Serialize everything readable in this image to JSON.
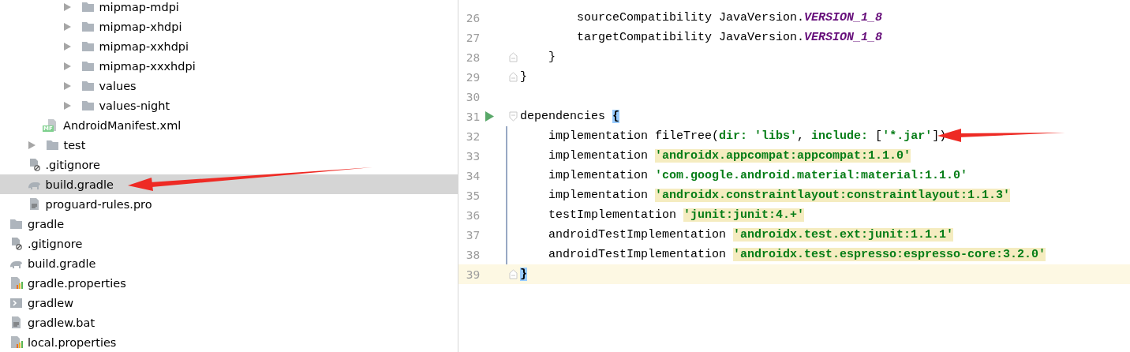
{
  "project_tree": {
    "items": [
      {
        "children": [
          {
            "children": [
              {
                "children": [
                  {
                    "label": "mipmap-mdpi",
                    "kind": "folder",
                    "expandable": true,
                    "selected": false
                  },
                  {
                    "label": "mipmap-xhdpi",
                    "kind": "folder",
                    "expandable": true,
                    "selected": false
                  },
                  {
                    "label": "mipmap-xxhdpi",
                    "kind": "folder",
                    "expandable": true,
                    "selected": false
                  },
                  {
                    "label": "mipmap-xxxhdpi",
                    "kind": "folder",
                    "expandable": true,
                    "selected": false
                  },
                  {
                    "label": "values",
                    "kind": "folder",
                    "expandable": true,
                    "selected": false
                  },
                  {
                    "label": "values-night",
                    "kind": "folder",
                    "expandable": true,
                    "selected": false
                  }
                ]
              },
              {
                "label": "AndroidManifest.xml",
                "kind": "manifest",
                "badge": "MF",
                "expandable": false,
                "selected": false
              }
            ]
          },
          {
            "label": "test",
            "kind": "folder",
            "expandable": true,
            "selected": false
          },
          {
            "label": ".gitignore",
            "kind": "ignore",
            "expandable": false,
            "selected": false
          },
          {
            "label": "build.gradle",
            "kind": "gradle",
            "expandable": false,
            "selected": true
          },
          {
            "label": "proguard-rules.pro",
            "kind": "text",
            "expandable": false,
            "selected": false
          }
        ]
      },
      {
        "label": "gradle",
        "kind": "folder",
        "expandable": false,
        "selected": false
      },
      {
        "label": ".gitignore",
        "kind": "ignore",
        "expandable": false,
        "selected": false
      },
      {
        "label": "build.gradle",
        "kind": "gradle",
        "expandable": false,
        "selected": false
      },
      {
        "label": "gradle.properties",
        "kind": "properties",
        "expandable": false,
        "selected": false
      },
      {
        "label": "gradlew",
        "kind": "shell",
        "expandable": false,
        "selected": false
      },
      {
        "label": "gradlew.bat",
        "kind": "text",
        "expandable": false,
        "selected": false
      },
      {
        "label": "local.properties",
        "kind": "properties",
        "expandable": false,
        "selected": false
      }
    ]
  },
  "editor": {
    "lines": [
      {
        "number": "26",
        "fold_start": false,
        "fold_end": false,
        "run": false,
        "current": false,
        "changed": false,
        "tokens": [
          {
            "kind": "plain",
            "text": "        sourceCompatibility JavaVersion."
          },
          {
            "kind": "constant",
            "text": "VERSION_1_8"
          }
        ]
      },
      {
        "number": "27",
        "fold_start": false,
        "fold_end": false,
        "run": false,
        "current": false,
        "changed": false,
        "tokens": [
          {
            "kind": "plain",
            "text": "        targetCompatibility JavaVersion."
          },
          {
            "kind": "constant",
            "text": "VERSION_1_8"
          }
        ]
      },
      {
        "number": "28",
        "fold_start": false,
        "fold_end": true,
        "run": false,
        "current": false,
        "changed": false,
        "tokens": [
          {
            "kind": "plain",
            "text": "    }"
          }
        ]
      },
      {
        "number": "29",
        "fold_start": false,
        "fold_end": true,
        "run": false,
        "current": false,
        "changed": false,
        "tokens": [
          {
            "kind": "plain",
            "text": "}"
          }
        ]
      },
      {
        "number": "30",
        "fold_start": false,
        "fold_end": false,
        "run": false,
        "current": false,
        "changed": false
      },
      {
        "number": "31",
        "fold_start": true,
        "fold_end": false,
        "run": true,
        "current": false,
        "changed": false,
        "tokens": [
          {
            "kind": "plain",
            "text": "dependencies "
          },
          {
            "kind": "brace",
            "matched": true,
            "text": "{"
          }
        ]
      },
      {
        "number": "32",
        "fold_start": false,
        "fold_end": false,
        "run": false,
        "current": false,
        "changed": true,
        "tokens": [
          {
            "kind": "plain",
            "text": "    implementation fileTree("
          },
          {
            "kind": "named",
            "text": "dir: "
          },
          {
            "kind": "string",
            "highlighted": false,
            "text": "'libs'"
          },
          {
            "kind": "plain",
            "text": ", "
          },
          {
            "kind": "named",
            "text": "include: "
          },
          {
            "kind": "plain",
            "text": "["
          },
          {
            "kind": "string",
            "highlighted": false,
            "text": "'*.jar'"
          },
          {
            "kind": "plain",
            "text": "])"
          }
        ]
      },
      {
        "number": "33",
        "fold_start": false,
        "fold_end": false,
        "run": false,
        "current": false,
        "changed": true,
        "tokens": [
          {
            "kind": "plain",
            "text": "    implementation "
          },
          {
            "kind": "string",
            "highlighted": true,
            "text": "'androidx.appcompat:appcompat:1.1.0'"
          }
        ]
      },
      {
        "number": "34",
        "fold_start": false,
        "fold_end": false,
        "run": false,
        "current": false,
        "changed": true,
        "tokens": [
          {
            "kind": "plain",
            "text": "    implementation "
          },
          {
            "kind": "string",
            "highlighted": false,
            "text": "'com.google.android.material:material:1.1.0'"
          }
        ]
      },
      {
        "number": "35",
        "fold_start": false,
        "fold_end": false,
        "run": false,
        "current": false,
        "changed": true,
        "tokens": [
          {
            "kind": "plain",
            "text": "    implementation "
          },
          {
            "kind": "string",
            "highlighted": true,
            "text": "'androidx.constraintlayout:constraintlayout:1.1.3'"
          }
        ]
      },
      {
        "number": "36",
        "fold_start": false,
        "fold_end": false,
        "run": false,
        "current": false,
        "changed": true,
        "tokens": [
          {
            "kind": "plain",
            "text": "    testImplementation "
          },
          {
            "kind": "string",
            "highlighted": true,
            "text": "'junit:junit:4.+'"
          }
        ]
      },
      {
        "number": "37",
        "fold_start": false,
        "fold_end": false,
        "run": false,
        "current": false,
        "changed": true,
        "tokens": [
          {
            "kind": "plain",
            "text": "    androidTestImplementation "
          },
          {
            "kind": "string",
            "highlighted": true,
            "text": "'androidx.test.ext:junit:1.1.1'"
          }
        ]
      },
      {
        "number": "38",
        "fold_start": false,
        "fold_end": false,
        "run": false,
        "current": false,
        "changed": true,
        "tokens": [
          {
            "kind": "plain",
            "text": "    androidTestImplementation "
          },
          {
            "kind": "string",
            "highlighted": true,
            "text": "'androidx.test.espresso:espresso-core:3.2.0'"
          }
        ]
      },
      {
        "number": "39",
        "fold_start": false,
        "fold_end": true,
        "run": false,
        "current": true,
        "changed": false,
        "tokens": [
          {
            "kind": "brace",
            "matched": true,
            "text": "}"
          }
        ]
      }
    ]
  }
}
